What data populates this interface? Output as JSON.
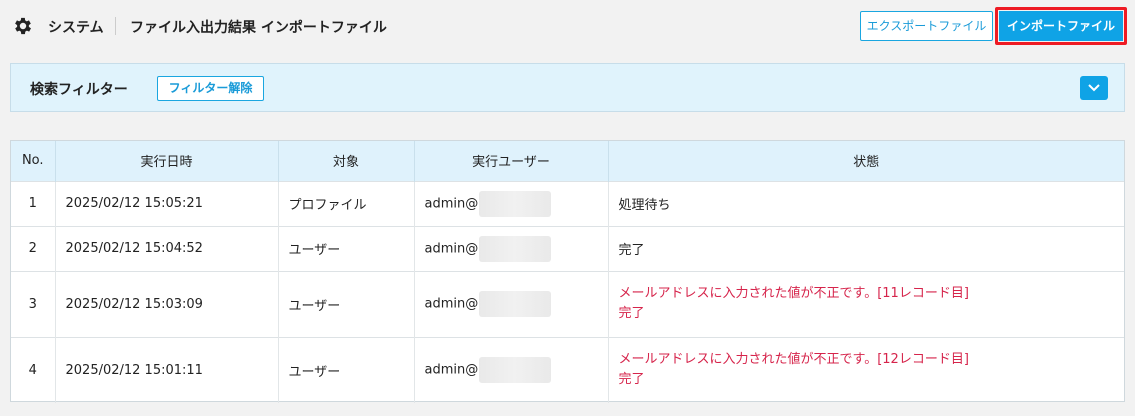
{
  "header": {
    "section": "システム",
    "page_title": "ファイル入出力結果 インポートファイル",
    "export_button": "エクスポートファイル",
    "import_button": "インポートファイル",
    "icon": "gear-icon"
  },
  "filter": {
    "title": "検索フィルター",
    "clear_button": "フィルター解除",
    "toggle_icon": "chevron-down-icon"
  },
  "table": {
    "columns": [
      "No.",
      "実行日時",
      "対象",
      "実行ユーザー",
      "状態"
    ],
    "rows": [
      {
        "no": "1",
        "datetime": "2025/02/12 15:05:21",
        "target": "プロファイル",
        "user": "admin@",
        "status": [
          "処理待ち"
        ],
        "error": false
      },
      {
        "no": "2",
        "datetime": "2025/02/12 15:04:52",
        "target": "ユーザー",
        "user": "admin@",
        "status": [
          "完了"
        ],
        "error": false
      },
      {
        "no": "3",
        "datetime": "2025/02/12 15:03:09",
        "target": "ユーザー",
        "user": "admin@",
        "status": [
          "メールアドレスに入力された値が不正です。[11レコード目]",
          "完了"
        ],
        "error": true
      },
      {
        "no": "4",
        "datetime": "2025/02/12 15:01:11",
        "target": "ユーザー",
        "user": "admin@",
        "status": [
          "メールアドレスに入力された値が不正です。[12レコード目]",
          "完了"
        ],
        "error": true
      }
    ]
  },
  "colors": {
    "accent": "#0fa3e6",
    "highlight_outline": "#ee1b24",
    "error_text": "#d6244b"
  }
}
